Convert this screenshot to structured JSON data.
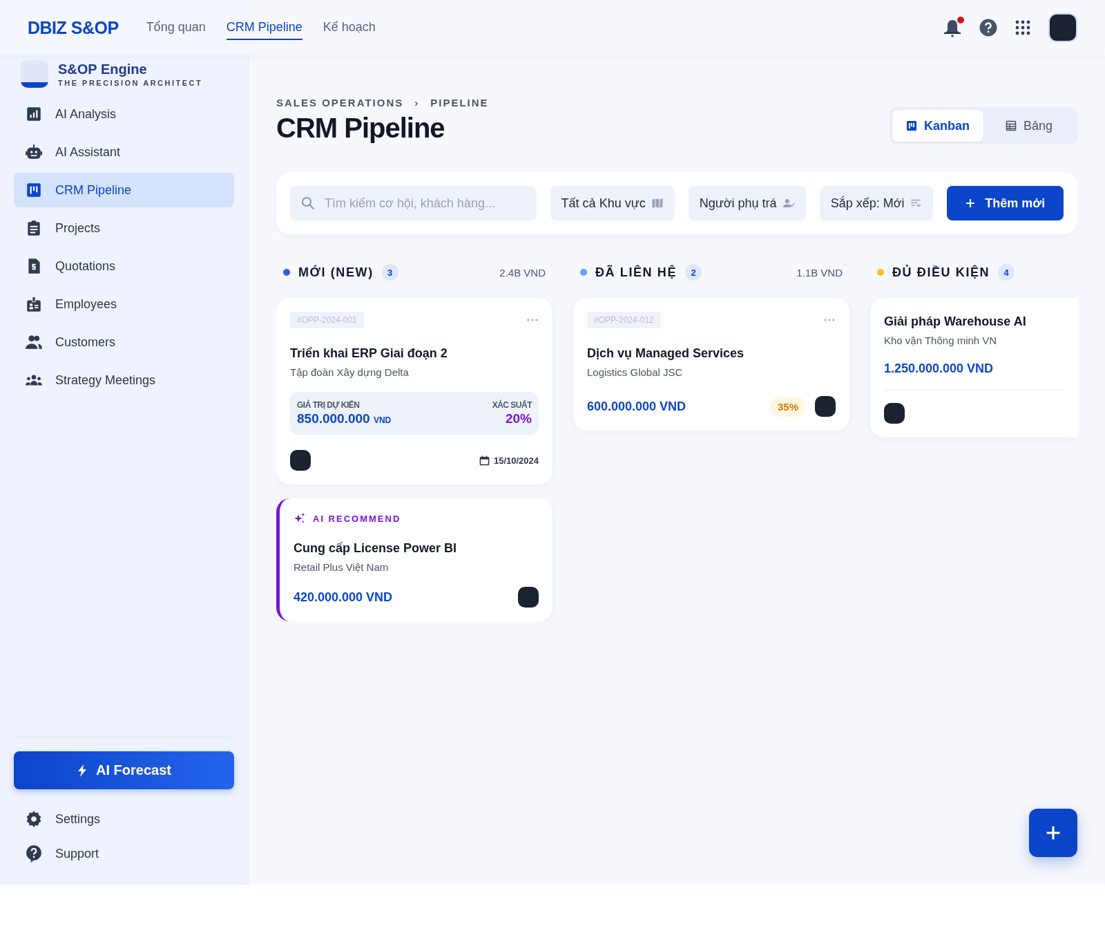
{
  "topbar": {
    "brand": "DBIZ S&OP",
    "nav": [
      {
        "label": "Tổng quan",
        "selected": false
      },
      {
        "label": "CRM Pipeline",
        "selected": true
      },
      {
        "label": "Kế hoạch",
        "selected": false
      }
    ],
    "notifications_unread": true
  },
  "sidebar": {
    "brand": {
      "title": "S&OP Engine",
      "subtitle": "THE PRECISION ARCHITECT"
    },
    "items": [
      {
        "label": "AI Analysis",
        "selected": false
      },
      {
        "label": "AI Assistant",
        "selected": false
      },
      {
        "label": "CRM Pipeline",
        "selected": true
      },
      {
        "label": "Projects",
        "selected": false
      },
      {
        "label": "Quotations",
        "selected": false
      },
      {
        "label": "Employees",
        "selected": false
      },
      {
        "label": "Customers",
        "selected": false
      },
      {
        "label": "Strategy Meetings",
        "selected": false
      }
    ],
    "forecast_button": "AI Forecast",
    "footer_items": [
      {
        "label": "Settings"
      },
      {
        "label": "Support"
      }
    ]
  },
  "header": {
    "breadcrumb": [
      "SALES OPERATIONS",
      "PIPELINE"
    ],
    "breadcrumb_separator": "›",
    "title": "CRM Pipeline",
    "view_toggle": [
      {
        "label": "Kanban",
        "selected": true
      },
      {
        "label": "Bảng",
        "selected": false
      }
    ]
  },
  "filters": {
    "search": {
      "placeholder": "Tìm kiếm cơ hội, khách hàng..."
    },
    "dropdowns": [
      "Tất cả Khu vực",
      "Người phụ trá",
      "Sắp xếp: Mới"
    ],
    "add_button": "Thêm mới"
  },
  "columns": [
    {
      "title": "MỚI (NEW)",
      "count": "3",
      "total": "2.4B VND",
      "color": "#2563eb",
      "cards": [
        {
          "kind": "detailed",
          "id": "#OPP-2024-001",
          "title": "Triển khai ERP Giai đoạn 2",
          "company": "Tập đoàn Xây dựng Delta",
          "value_label": "GIÁ TRỊ DỰ KIẾN",
          "value": "850.000.000",
          "currency": "VND",
          "probability_label": "XÁC SUẤT",
          "probability": "20%",
          "date": "15/10/2024"
        },
        {
          "kind": "ai",
          "badge": "AI RECOMMEND",
          "title": "Cung cấp License Power BI",
          "company": "Retail Plus Việt Nam",
          "value": "420.000.000 VND"
        }
      ]
    },
    {
      "title": "ĐÃ LIÊN HỆ",
      "count": "2",
      "total": "1.1B VND",
      "color": "#60a5fa",
      "cards": [
        {
          "kind": "compact",
          "id": "#OPP-2024-012",
          "title": "Dịch vụ Managed Services",
          "company": "Logistics Global JSC",
          "value": "600.000.000 VND",
          "probability": "35%"
        }
      ]
    },
    {
      "title": "ĐỦ ĐIỀU KIỆN",
      "count": "4",
      "color": "#fbbf24",
      "cards": [
        {
          "kind": "simple",
          "title": "Giải pháp Warehouse AI",
          "company": "Kho vận Thông minh VN",
          "value": "1.250.000.000 VND"
        }
      ]
    }
  ]
}
